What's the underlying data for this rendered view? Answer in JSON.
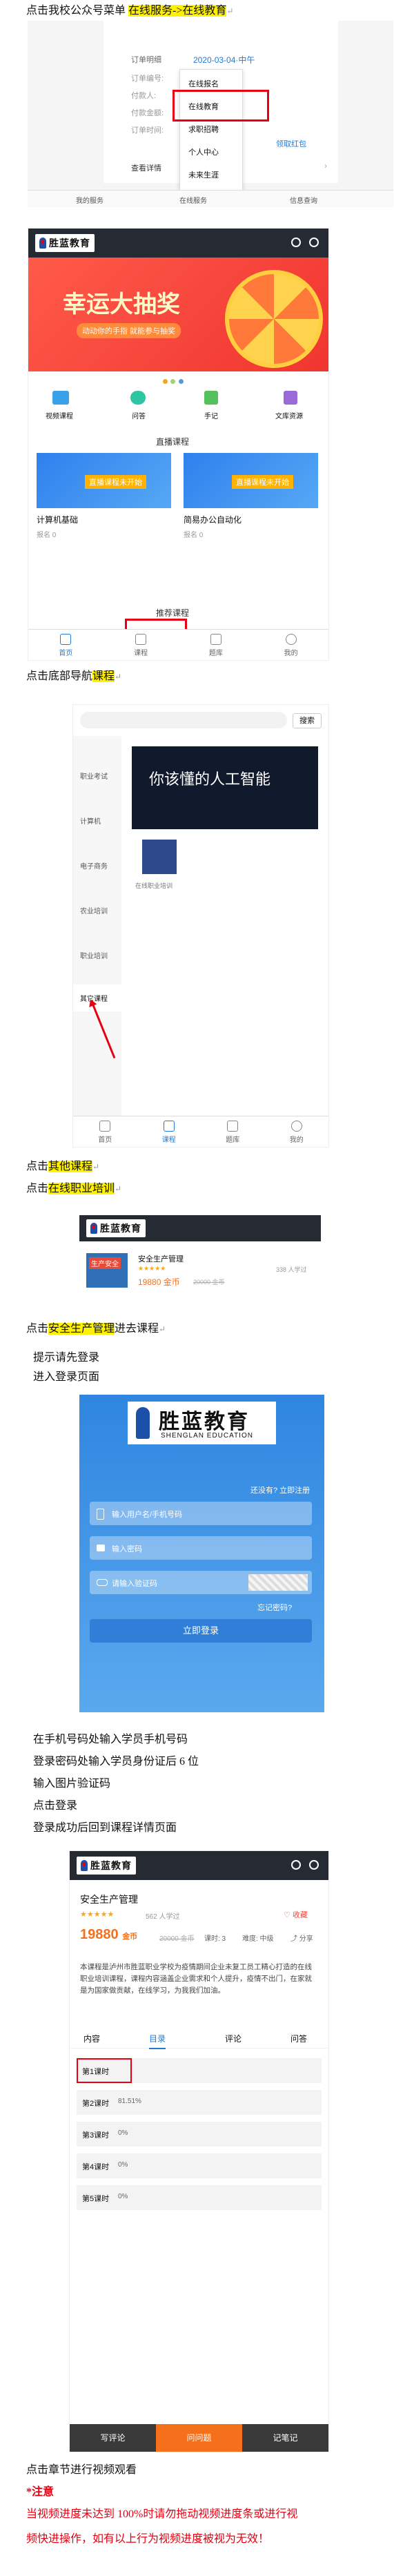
{
  "steps": {
    "s1_prefix": "点击我校公众号菜单",
    "s1_highlight": "在线服务->在线教育",
    "s2_prefix": "点击底部导航",
    "s2_highlight": "课程",
    "s3_prefix": "点击",
    "s3_highlight": "其他课程",
    "s4_prefix": "点击",
    "s4_highlight": "在线职业培训",
    "s5_prefix": "点击",
    "s5_highlight": "安全生产管理",
    "s5_suffix": "进去课程",
    "s6_lines": [
      "提示请先登录",
      "进入登录页面"
    ],
    "s7_lines": [
      "在手机号码处输入学员手机号码",
      "登录密码处输入学员身份证后 6 位",
      "输入图片验证码",
      "点击登录",
      "登录成功后回到课程详情页面"
    ],
    "s8": "点击章节进行视频观看",
    "note_label": "*注意",
    "note_line1": "当视频进度未达到  100%时请勿拖动视频进度条或进行视",
    "note_line2": "频快进操作，如有以上行为视频进度被视为无效！",
    "end_mark": "↵"
  },
  "shot1": {
    "order_title_label": "订单明细",
    "order_date": "2020-03-04·中午",
    "order_rows": [
      "订单编号:",
      "付款人:",
      "付款金额:",
      "订单时间:"
    ],
    "menu_items": [
      "在线报名",
      "在线教育",
      "求职招聘",
      "个人中心",
      "未来生涯"
    ],
    "check_details": "查看详情",
    "bottom_tabs": [
      "我的服务",
      "在线服务",
      "信息查询"
    ],
    "cta": "领取红包"
  },
  "shot2": {
    "brand": "胜蓝教育",
    "banner_title": "幸运大抽奖",
    "banner_sub": "动动你的手指 就能参与抽奖",
    "cats": [
      "视频课程",
      "问答",
      "手记",
      "文库资源"
    ],
    "live_title": "直播课程",
    "courses": [
      {
        "name": "计算机基础",
        "stat": "报名 0",
        "cover": "直播课程未开始"
      },
      {
        "name": "简易办公自动化",
        "stat": "报名 0",
        "cover": "直播课程未开始"
      }
    ],
    "rec_title": "推荐课程",
    "nav": [
      "首页",
      "课程",
      "题库",
      "我的"
    ]
  },
  "shot3": {
    "search_btn": "搜索",
    "side": [
      "职业考试",
      "计算机",
      "电子商务",
      "农业培训",
      "职业培训",
      "其它课程"
    ],
    "ai_banner": "你该懂的人工智能",
    "item_label": "在线职业培训",
    "nav": [
      "首页",
      "课程",
      "题库",
      "我的"
    ]
  },
  "shot4": {
    "brand": "胜蓝教育",
    "course": "安全生产管理",
    "thumb": "生产安全",
    "rating": "★★★★★",
    "learners": "338 人学过",
    "price": "19880 金币",
    "old_price": "20000 金币"
  },
  "shot5": {
    "brand_cn": "胜蓝教育",
    "brand_en": "SHENGLAN EDUCATION",
    "register": "还没有? 立即注册",
    "phone_ph": "输入用户名/手机号码",
    "pwd_ph": "输入密码",
    "captcha_ph": "请输入验证码",
    "forgot": "忘记密码?",
    "login": "立即登录"
  },
  "shot6": {
    "brand": "胜蓝教育",
    "course": "安全生产管理",
    "rating": "★★★★★",
    "learners": "562 人学过",
    "price": "19880",
    "price_unit": "金币",
    "old_price": "20000 金币",
    "chapters_label": "课时: 3",
    "difficulty": "难度: 中级",
    "collect": "收藏",
    "share": "分享",
    "desc": "本课程是泸州市胜蓝职业学校为疫情期间企业未复工员工精心打造的在线职业培训课程，课程内容涵盖企业需求和个人提升，疫情不出门，在家就是为国家做贡献，在线学习，为我我们加油。",
    "tabs": [
      "内容",
      "目录",
      "评论",
      "问答"
    ],
    "lessons": [
      {
        "name": "第1课时",
        "pct": ""
      },
      {
        "name": "第2课时",
        "pct": "81.51%"
      },
      {
        "name": "第3课时",
        "pct": "0%"
      },
      {
        "name": "第4课时",
        "pct": "0%"
      },
      {
        "name": "第5课时",
        "pct": "0%"
      }
    ],
    "bottom": [
      "写评论",
      "问问题",
      "记笔记"
    ]
  }
}
